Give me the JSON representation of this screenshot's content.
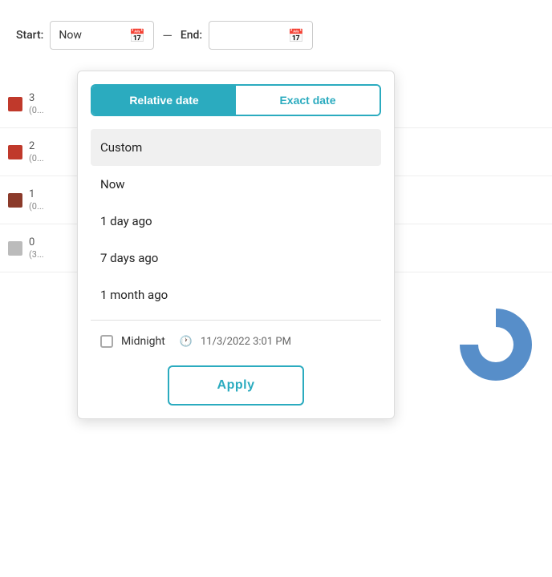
{
  "header": {
    "start_label": "Start:",
    "start_value": "Now",
    "end_label": "End:",
    "end_value": "",
    "separator": "—"
  },
  "dropdown": {
    "tabs": [
      {
        "id": "relative",
        "label": "Relative date",
        "active": true
      },
      {
        "id": "exact",
        "label": "Exact date",
        "active": false
      }
    ],
    "items": [
      {
        "id": "custom",
        "label": "Custom",
        "selected": true
      },
      {
        "id": "now",
        "label": "Now",
        "selected": false
      },
      {
        "id": "1day",
        "label": "1 day ago",
        "selected": false
      },
      {
        "id": "7days",
        "label": "7 days ago",
        "selected": false
      },
      {
        "id": "1month",
        "label": "1 month ago",
        "selected": false
      }
    ],
    "midnight_label": "Midnight",
    "datetime_text": "11/3/2022 3:01 PM",
    "apply_label": "Apply"
  },
  "background": {
    "rows": [
      {
        "color": "#c0392b",
        "text1": "3",
        "text2": "(0..."
      },
      {
        "color": "#e74c3c",
        "text1": "2",
        "text2": "(0..."
      },
      {
        "color": "#8b4513",
        "text1": "1",
        "text2": "(0..."
      },
      {
        "color": "#bbb",
        "text1": "0",
        "text2": "(3..."
      }
    ]
  },
  "icons": {
    "calendar": "📅",
    "clock": "🕐"
  }
}
